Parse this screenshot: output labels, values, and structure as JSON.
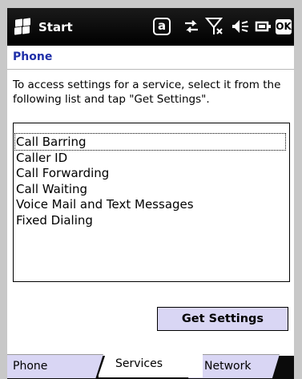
{
  "statusbar": {
    "start_label": "Start",
    "icons": [
      "windows-logo-icon",
      "at-icon",
      "sync-icon",
      "no-signal-icon",
      "volume-muted-icon",
      "battery-icon",
      "ok-icon"
    ],
    "at_glyph": "a",
    "ok_label": "OK"
  },
  "title": "Phone",
  "description": "To access settings for a service, select it from the following list and tap \"Get Settings\".",
  "services": [
    "Call Barring",
    "Caller ID",
    "Call Forwarding",
    "Call Waiting",
    "Voice Mail and Text Messages",
    "Fixed Dialing"
  ],
  "selected_index": 0,
  "get_settings_label": "Get Settings",
  "tabs": [
    "Phone",
    "Services",
    "Network"
  ],
  "active_tab": "Services",
  "colors": {
    "title": "#1f2fa8",
    "button_bg": "#d9d6f4",
    "tab_inactive": "#d9d6f4"
  }
}
